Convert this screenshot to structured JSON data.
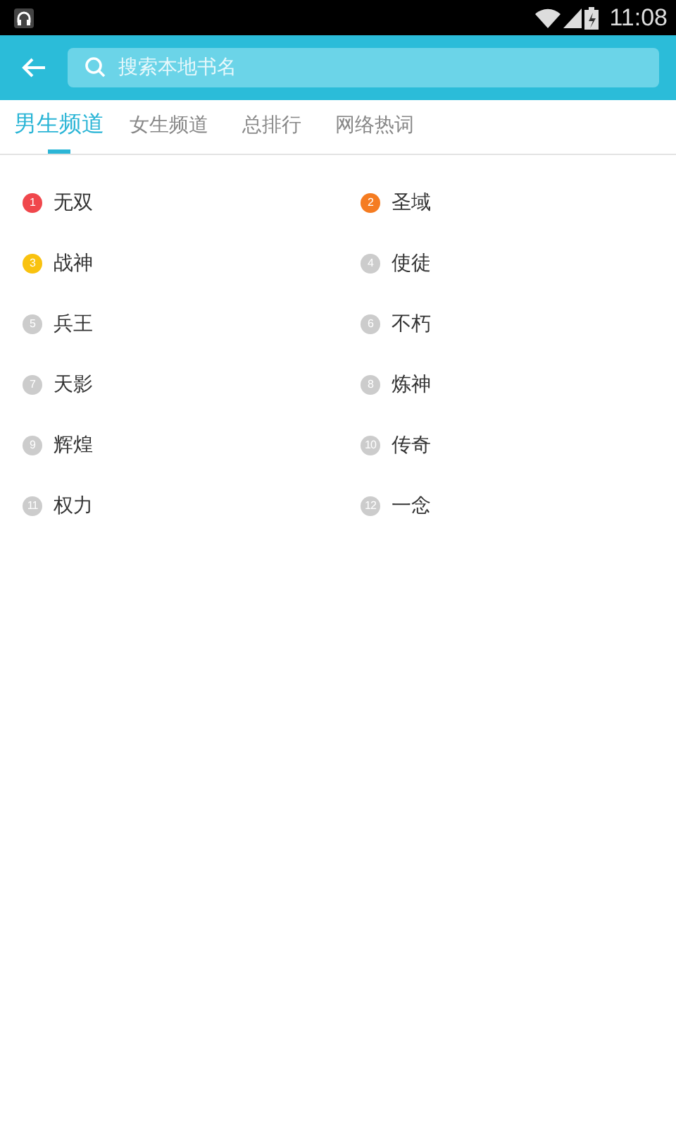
{
  "status_bar": {
    "time": "11:08"
  },
  "search": {
    "placeholder": "搜索本地书名"
  },
  "tabs": [
    {
      "label": "男生频道",
      "selected": true
    },
    {
      "label": "女生频道",
      "selected": false
    },
    {
      "label": "总排行",
      "selected": false
    },
    {
      "label": "网络热词",
      "selected": false
    }
  ],
  "keywords": [
    {
      "rank": "1",
      "text": "无双",
      "color": "#f0474c"
    },
    {
      "rank": "2",
      "text": "圣域",
      "color": "#f57c21"
    },
    {
      "rank": "3",
      "text": "战神",
      "color": "#f9c20f"
    },
    {
      "rank": "4",
      "text": "使徒",
      "color": "#cccccc"
    },
    {
      "rank": "5",
      "text": "兵王",
      "color": "#cccccc"
    },
    {
      "rank": "6",
      "text": "不朽",
      "color": "#cccccc"
    },
    {
      "rank": "7",
      "text": "天影",
      "color": "#cccccc"
    },
    {
      "rank": "8",
      "text": "炼神",
      "color": "#cccccc"
    },
    {
      "rank": "9",
      "text": "辉煌",
      "color": "#cccccc"
    },
    {
      "rank": "10",
      "text": "传奇",
      "color": "#cccccc"
    },
    {
      "rank": "11",
      "text": "权力",
      "color": "#cccccc"
    },
    {
      "rank": "12",
      "text": "一念",
      "color": "#cccccc"
    }
  ]
}
